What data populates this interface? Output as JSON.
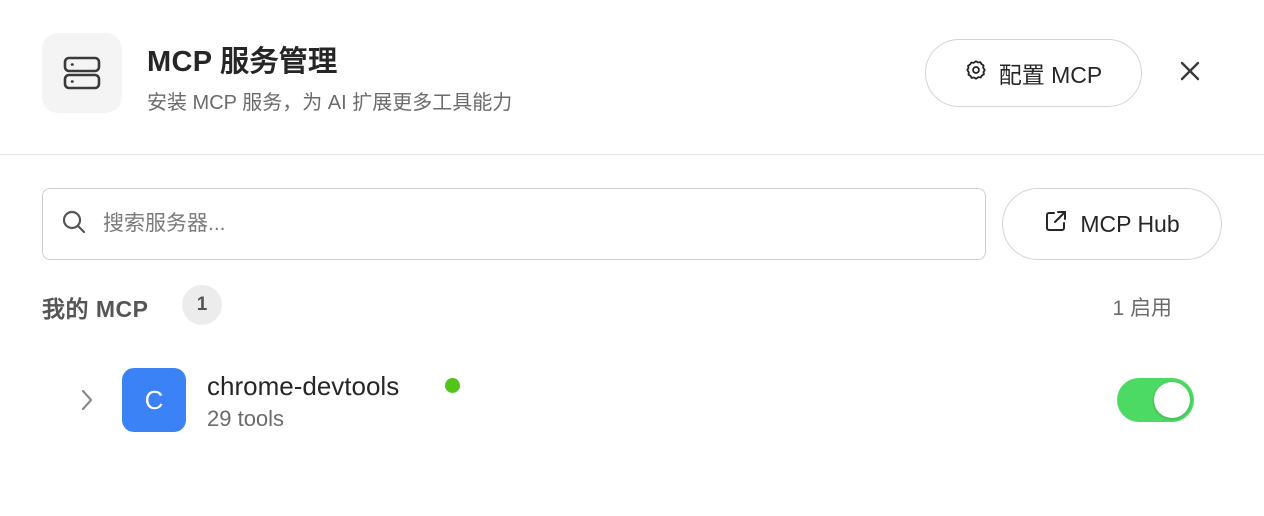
{
  "header": {
    "icon": "server-icon",
    "title": "MCP 服务管理",
    "subtitle": "安装 MCP 服务，为 AI 扩展更多工具能力",
    "config_button": {
      "icon": "gear-icon",
      "label": "配置 MCP"
    },
    "close_icon": "close-icon"
  },
  "search": {
    "icon": "search-icon",
    "placeholder": "搜索服务器...",
    "value": ""
  },
  "hub_button": {
    "icon": "external-link-icon",
    "label": "MCP Hub"
  },
  "section": {
    "title": "我的 MCP",
    "count": "1",
    "enabled_text": "1 启用"
  },
  "servers": [
    {
      "avatar_letter": "C",
      "avatar_color": "#3b82f6",
      "name": "chrome-devtools",
      "status_color": "#52c41a",
      "tools": "29 tools",
      "enabled": true
    }
  ],
  "colors": {
    "toggle_on": "#4cd964",
    "accent": "#3b82f6"
  }
}
